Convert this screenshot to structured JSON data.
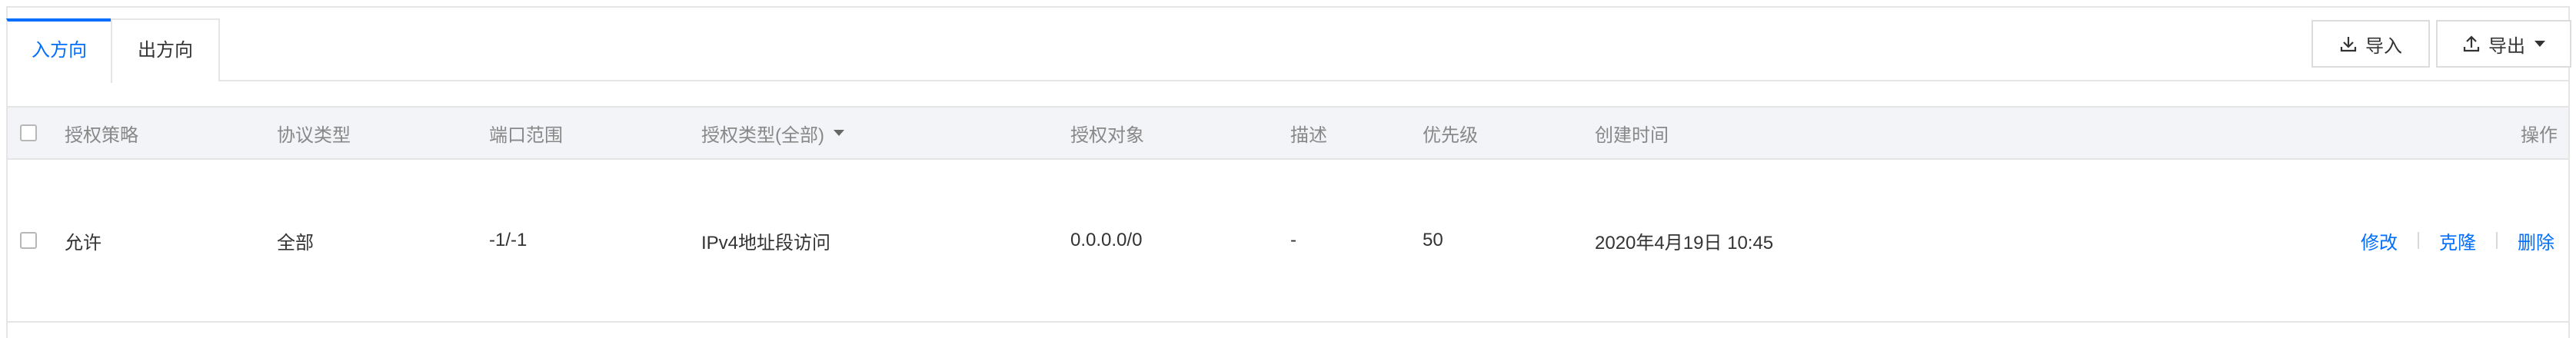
{
  "tabs": [
    {
      "label": "入方向",
      "active": true
    },
    {
      "label": "出方向",
      "active": false
    }
  ],
  "toolbar": {
    "import_label": "导入",
    "export_label": "导出"
  },
  "table": {
    "headers": [
      "授权策略",
      "协议类型",
      "端口范围",
      "授权类型(全部)",
      "授权对象",
      "描述",
      "优先级",
      "创建时间",
      "操作"
    ],
    "rows": [
      {
        "policy": "允许",
        "protocol": "全部",
        "port_range": "-1/-1",
        "auth_type": "IPv4地址段访问",
        "auth_object": "0.0.0.0/0",
        "description": "-",
        "priority": "50",
        "created": "2020年4月19日 10:45",
        "actions": [
          "修改",
          "克隆",
          "删除"
        ]
      }
    ]
  },
  "colors": {
    "accent": "#006eff",
    "header_bg": "#f3f4f7",
    "border": "#e5e5e5"
  }
}
